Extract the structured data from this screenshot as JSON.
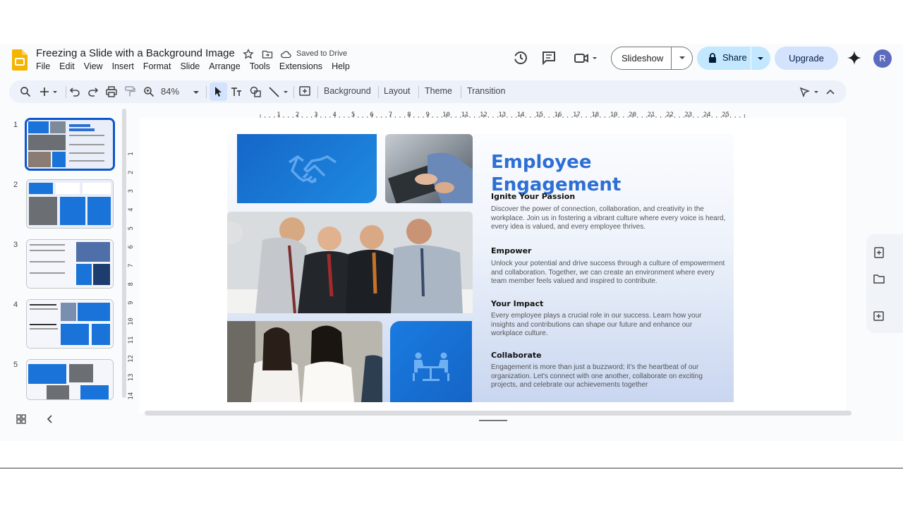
{
  "header": {
    "doc_title": "Freezing a Slide with a Background Image",
    "saved_status": "Saved to Drive",
    "menu": [
      "File",
      "Edit",
      "View",
      "Insert",
      "Format",
      "Slide",
      "Arrange",
      "Tools",
      "Extensions",
      "Help"
    ],
    "slideshow_label": "Slideshow",
    "share_label": "Share",
    "upgrade_label": "Upgrade",
    "avatar_initial": "R"
  },
  "toolbar": {
    "zoom": "84%",
    "background_label": "Background",
    "layout_label": "Layout",
    "theme_label": "Theme",
    "transition_label": "Transition"
  },
  "filmstrip": {
    "numbers": [
      "1",
      "2",
      "3",
      "4",
      "5"
    ]
  },
  "ruler": {
    "h_ticks": [
      "1",
      "2",
      "3",
      "4",
      "5",
      "6",
      "7",
      "8",
      "9",
      "10",
      "11",
      "12",
      "13",
      "14",
      "15",
      "16",
      "17",
      "18",
      "19",
      "20",
      "21",
      "22",
      "23",
      "24",
      "25"
    ],
    "v_ticks": [
      "1",
      "2",
      "3",
      "4",
      "5",
      "6",
      "7",
      "8",
      "9",
      "10",
      "11",
      "12",
      "13",
      "14"
    ]
  },
  "slide": {
    "title_line1": "Employee",
    "title_line2": "Engagement",
    "sections": [
      {
        "heading": "Ignite Your Passion",
        "body": "Discover the power of connection, collaboration, and creativity in the workplace. Join us in fostering a vibrant culture where every voice is heard, every idea is valued, and every employee thrives."
      },
      {
        "heading": "Empower",
        "body": "Unlock your potential and drive success through a culture of empowerment and collaboration. Together, we can create an environment where every team member feels valued and inspired to contribute."
      },
      {
        "heading": "Your Impact",
        "body": "Every employee plays a crucial role in our success. Learn how your insights and contributions can shape our future and enhance our workplace culture."
      },
      {
        "heading": "Collaborate",
        "body": "Engagement is more than just a buzzword; it's the heartbeat of our organization. Let's connect with one another, collaborate on exciting projects, and celebrate our achievements together"
      }
    ]
  },
  "colors": {
    "accent": "#0b57d0",
    "slide_title": "#2d6fd3",
    "tile_blue": "#1a73d9",
    "share_bg": "#c2e7ff",
    "upgrade_bg": "#d3e3fd"
  }
}
